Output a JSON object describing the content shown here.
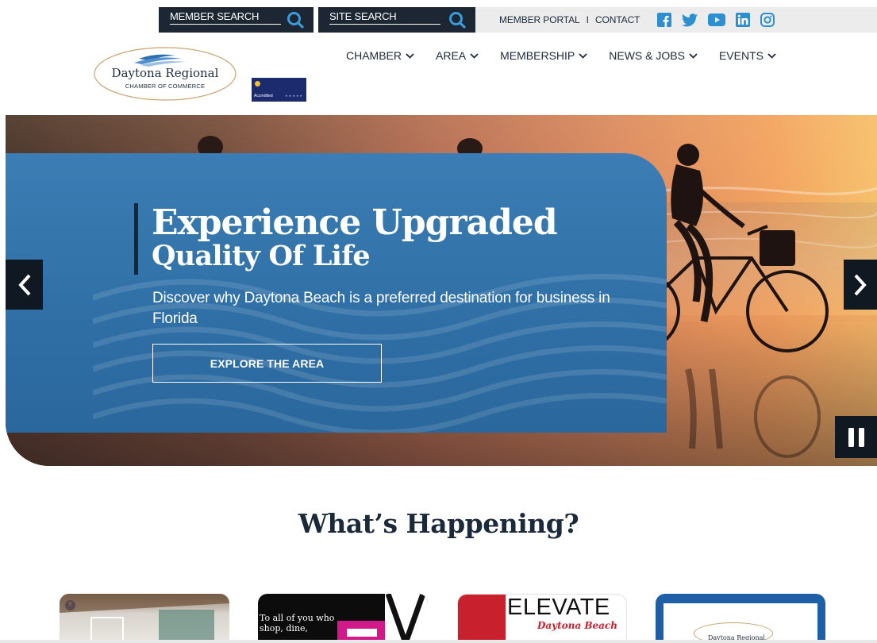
{
  "topbar": {
    "member_search_label": "MEMBER SEARCH",
    "site_search_label": "SITE SEARCH",
    "member_portal": "MEMBER PORTAL",
    "separator": "I",
    "contact": "CONTACT",
    "social_icons": [
      "facebook-icon",
      "twitter-icon",
      "youtube-icon",
      "linkedin-icon",
      "instagram-icon"
    ],
    "social_color": "#2e8fd0"
  },
  "logo": {
    "name": "Daytona Regional",
    "subtitle": "CHAMBER OF COMMERCE",
    "accreditation": "Accredited"
  },
  "nav": {
    "items": [
      "CHAMBER",
      "AREA",
      "MEMBERSHIP",
      "NEWS & JOBS",
      "EVENTS"
    ]
  },
  "hero": {
    "title_line1": "Experience Upgraded",
    "title_line2": "Quality Of Life",
    "subtitle": "Discover why Daytona Beach is a preferred destination for business in Florida",
    "button_label": "EXPLORE THE AREA",
    "panel_color": "#3379b1"
  },
  "section": {
    "title": "What’s Happening?"
  },
  "cards": {
    "card2_text": "To all of you who shop, dine,",
    "card3_title": "ELEVATE",
    "card3_subtitle": "Daytona Beach",
    "card4_logo": "Daytona Regional"
  }
}
